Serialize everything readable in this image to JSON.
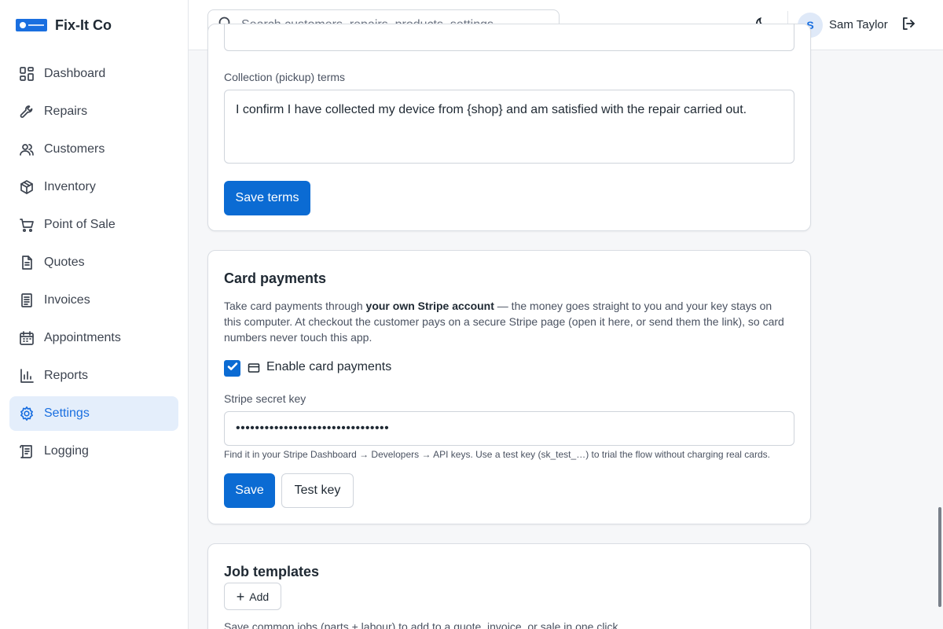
{
  "brand": {
    "name": "Fix-It Co",
    "logo_icon": "fix-it-co-logo"
  },
  "sidebar": {
    "items": [
      {
        "label": "Dashboard",
        "icon": "dashboard-icon"
      },
      {
        "label": "Repairs",
        "icon": "wrench-icon"
      },
      {
        "label": "Customers",
        "icon": "users-icon"
      },
      {
        "label": "Inventory",
        "icon": "box-icon"
      },
      {
        "label": "Point of Sale",
        "icon": "cart-icon"
      },
      {
        "label": "Quotes",
        "icon": "document-icon"
      },
      {
        "label": "Invoices",
        "icon": "receipt-icon"
      },
      {
        "label": "Appointments",
        "icon": "calendar-icon"
      },
      {
        "label": "Reports",
        "icon": "bar-chart-icon"
      },
      {
        "label": "Settings",
        "icon": "gear-icon",
        "active": true
      },
      {
        "label": "Logging",
        "icon": "log-icon"
      }
    ]
  },
  "topbar": {
    "search_placeholder": "Search customers, repairs, products, settings…",
    "user_initial": "S",
    "user_name": "Sam Taylor"
  },
  "terms_card": {
    "collection_label": "Collection (pickup) terms",
    "collection_text": "I confirm I have collected my device from {shop} and am satisfied with the repair carried out.",
    "save_label": "Save terms"
  },
  "card_payments": {
    "title": "Card payments",
    "desc_part1": "Take card payments through ",
    "desc_bold": "your own Stripe account",
    "desc_part2": " — the money goes straight to you and your key stays on this computer. At checkout the customer pays on a secure Stripe page (open it here, or send them the link), so card numbers never touch this app.",
    "enable_label": "Enable card payments",
    "enabled": true,
    "key_label": "Stripe secret key",
    "key_value": "••••••••••••••••••••••••••••••••",
    "help_text": "Find it in your Stripe Dashboard → Developers → API keys. Use a test key (sk_test_…) to trial the flow without charging real cards.",
    "save_label": "Save",
    "test_label": "Test key"
  },
  "job_templates": {
    "title": "Job templates",
    "add_label": "Add",
    "desc": "Save common jobs (parts + labour) to add to a quote, invoice, or sale in one click."
  },
  "colors": {
    "accent": "#0b6bd3",
    "active_nav_bg": "#e4eefb"
  }
}
